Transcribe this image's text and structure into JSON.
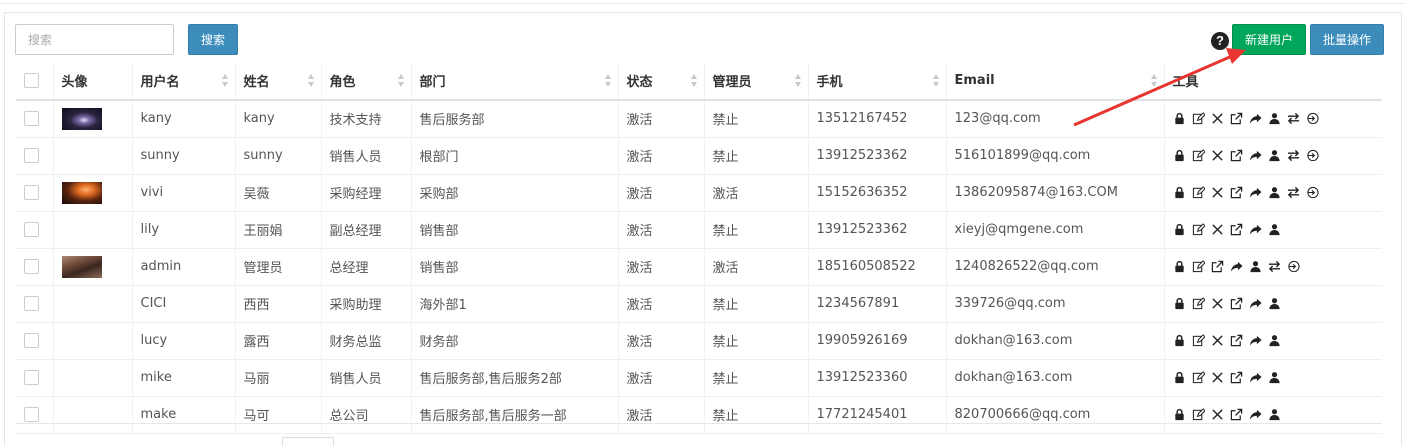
{
  "toolbar": {
    "search_placeholder": "搜索",
    "search_label": "搜索",
    "new_user_label": "新建用户",
    "batch_label": "批量操作",
    "help_glyph": "?"
  },
  "table": {
    "columns": [
      "头像",
      "用户名",
      "姓名",
      "角色",
      "部门",
      "状态",
      "管理员",
      "手机",
      "Email",
      "工具"
    ],
    "rows": [
      {
        "username": "kany",
        "name": "kany",
        "role": "技术支持",
        "dept": "售后服务部",
        "status": "激活",
        "admin": "禁止",
        "phone": "13512167452",
        "email": "123@qq.com",
        "tools": [
          "lock-icon",
          "edit-icon",
          "delete-icon",
          "open-icon",
          "share-icon",
          "user-icon",
          "transfer-icon",
          "login-icon"
        ]
      },
      {
        "username": "sunny",
        "name": "sunny",
        "role": "销售人员",
        "dept": "根部门",
        "status": "激活",
        "admin": "禁止",
        "phone": "13912523362",
        "email": "516101899@qq.com",
        "tools": [
          "lock-icon",
          "edit-icon",
          "delete-icon",
          "open-icon",
          "share-icon",
          "user-icon",
          "transfer-icon",
          "login-icon"
        ]
      },
      {
        "username": "vivi",
        "name": "吴薇",
        "role": "采购经理",
        "dept": "采购部",
        "status": "激活",
        "admin": "激活",
        "phone": "15152636352",
        "email": "13862095874@163.COM",
        "tools": [
          "lock-icon",
          "edit-icon",
          "delete-icon",
          "open-icon",
          "share-icon",
          "user-icon",
          "transfer-icon",
          "login-icon"
        ]
      },
      {
        "username": "lily",
        "name": "王丽娟",
        "role": "副总经理",
        "dept": "销售部",
        "status": "激活",
        "admin": "禁止",
        "phone": "13912523362",
        "email": "xieyj@qmgene.com",
        "tools": [
          "lock-icon",
          "edit-icon",
          "delete-icon",
          "open-icon",
          "share-icon",
          "user-icon"
        ]
      },
      {
        "username": "admin",
        "name": "管理员",
        "role": "总经理",
        "dept": "销售部",
        "status": "激活",
        "admin": "激活",
        "phone": "185160508522",
        "email": "1240826522@qq.com",
        "tools": [
          "lock-icon",
          "edit-icon",
          "open-icon",
          "share-icon",
          "user-icon",
          "transfer-icon",
          "login-icon"
        ]
      },
      {
        "username": "CICI",
        "name": "西西",
        "role": "采购助理",
        "dept": "海外部1",
        "status": "激活",
        "admin": "禁止",
        "phone": "1234567891",
        "email": "339726@qq.com",
        "tools": [
          "lock-icon",
          "edit-icon",
          "delete-icon",
          "open-icon",
          "share-icon",
          "user-icon"
        ]
      },
      {
        "username": "lucy",
        "name": "露西",
        "role": "财务总监",
        "dept": "财务部",
        "status": "激活",
        "admin": "禁止",
        "phone": "19905926169",
        "email": "dokhan@163.com",
        "tools": [
          "lock-icon",
          "edit-icon",
          "delete-icon",
          "open-icon",
          "share-icon",
          "user-icon"
        ]
      },
      {
        "username": "mike",
        "name": "马丽",
        "role": "销售人员",
        "dept": "售后服务部,售后服务2部",
        "status": "激活",
        "admin": "禁止",
        "phone": "13912523360",
        "email": "dokhan@163.com",
        "tools": [
          "lock-icon",
          "edit-icon",
          "delete-icon",
          "open-icon",
          "share-icon",
          "user-icon"
        ]
      },
      {
        "username": "make",
        "name": "马可",
        "role": "总公司",
        "dept": "售后服务部,售后服务一部",
        "status": "激活",
        "admin": "禁止",
        "phone": "17721245401",
        "email": "820700666@qq.com",
        "tools": [
          "lock-icon",
          "edit-icon",
          "delete-icon",
          "open-icon",
          "share-icon",
          "user-icon"
        ]
      }
    ]
  },
  "colors": {
    "primary": "#3c8dbc",
    "success": "#00a65a",
    "annotation_arrow": "#e8352f"
  }
}
